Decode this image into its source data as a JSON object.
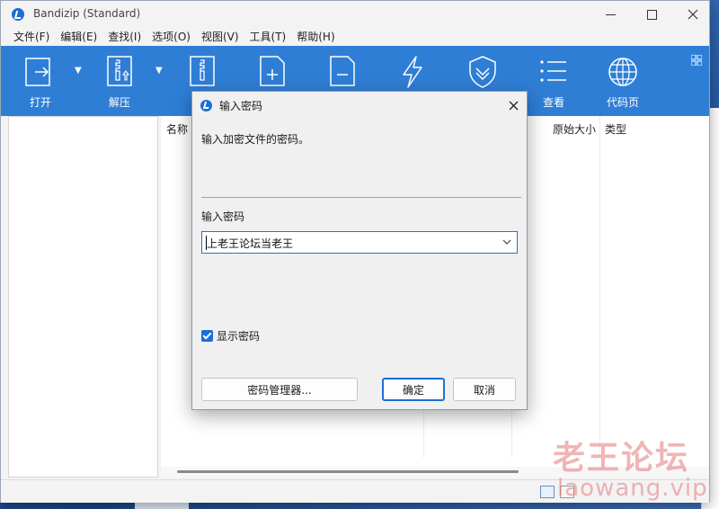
{
  "window": {
    "title": "Bandizip (Standard)"
  },
  "menu": {
    "items": [
      "文件(F)",
      "编辑(E)",
      "查找(I)",
      "选项(O)",
      "视图(V)",
      "工具(T)",
      "帮助(H)"
    ]
  },
  "toolbar": {
    "open_label": "打开",
    "extract_label": "解压",
    "view_label": "查看",
    "codepage_label": "代码页"
  },
  "file_list": {
    "columns": {
      "name": "名称",
      "original_size": "原始大小",
      "type": "类型"
    }
  },
  "dialog": {
    "title": "输入密码",
    "prompt": "输入加密文件的密码。",
    "password_label": "输入密码",
    "password_value": "上老王论坛当老王",
    "show_password_label": "显示密码",
    "show_password_checked": true,
    "manager_button": "密码管理器...",
    "ok_button": "确定",
    "cancel_button": "取消"
  },
  "colors": {
    "toolbar_bg": "#2f7ed6",
    "accent": "#1a6fd8"
  },
  "watermark": {
    "main": "老王论坛",
    "sub": "laowang.vip"
  },
  "icons": {
    "open": "open-arrow-icon",
    "extract": "zip-file-icon",
    "new": "new-archive-icon",
    "add": "add-file-icon",
    "remove": "remove-file-icon",
    "test": "lightning-icon",
    "shield": "shield-icon",
    "view": "list-view-icon",
    "codepage": "globe-icon"
  }
}
